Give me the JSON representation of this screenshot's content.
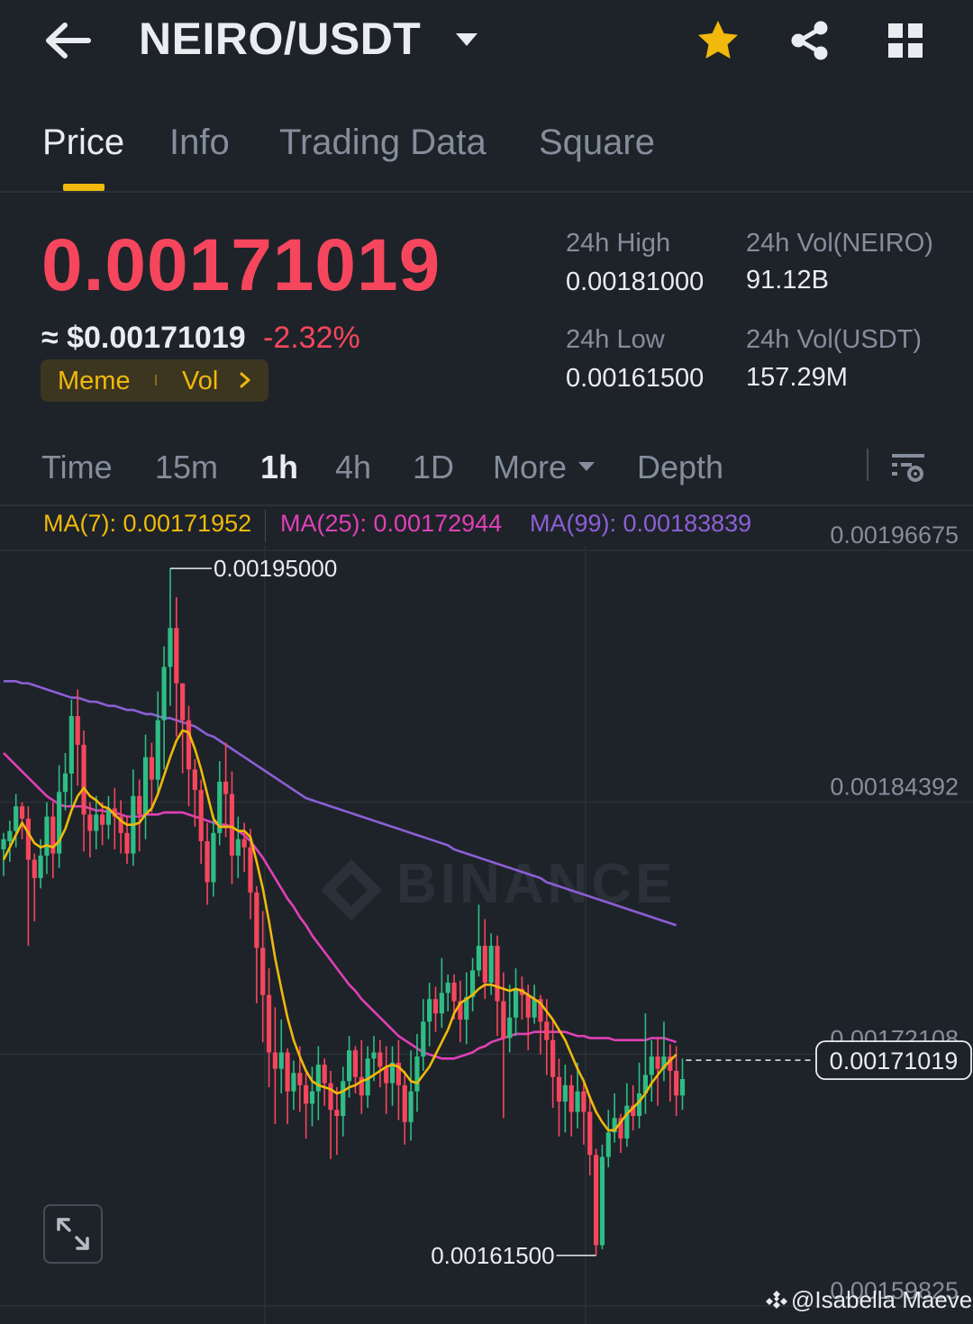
{
  "header": {
    "title": "NEIRO/USDT"
  },
  "tabs": [
    {
      "label": "Price",
      "active": true
    },
    {
      "label": "Info",
      "active": false
    },
    {
      "label": "Trading Data",
      "active": false
    },
    {
      "label": "Square",
      "active": false
    }
  ],
  "ticker": {
    "last_price": "0.00171019",
    "usd_price": "≈ $0.00171019",
    "change_pct": "-2.32%",
    "tags": {
      "meme": "Meme",
      "vol": "Vol"
    },
    "stats": {
      "high_label": "24h High",
      "high_value": "0.00181000",
      "low_label": "24h Low",
      "low_value": "0.00161500",
      "vol_base_label": "24h Vol(NEIRO)",
      "vol_base_value": "91.12B",
      "vol_quote_label": "24h Vol(USDT)",
      "vol_quote_value": "157.29M"
    }
  },
  "intervals": [
    {
      "label": "Time",
      "active": false
    },
    {
      "label": "15m",
      "active": false
    },
    {
      "label": "1h",
      "active": true
    },
    {
      "label": "4h",
      "active": false
    },
    {
      "label": "1D",
      "active": false
    },
    {
      "label": "More",
      "active": false
    },
    {
      "label": "Depth",
      "active": false
    }
  ],
  "ma_labels": {
    "ma7": "MA(7): 0.00171952",
    "ma25": "MA(25): 0.00172944",
    "ma99": "MA(99): 0.00183839"
  },
  "colors": {
    "up": "#2ebd85",
    "down": "#f6465d",
    "accent": "#f0b90b",
    "ma7": "#f0b90b",
    "ma25": "#e040b8",
    "ma99": "#8c5fd6"
  },
  "watermark": "BINANCE",
  "credit": "@Isabella Maeve",
  "chart_data": {
    "type": "candlestick",
    "y_ticks": [
      "0.00196675",
      "0.00184392",
      "0.00172108",
      "0.00159825"
    ],
    "ylim": [
      0.00158,
      0.00201
    ],
    "current_price_label": "0.00171019",
    "current_price": 0.00171019,
    "high_marker": {
      "label": "0.00195000",
      "value": 0.00195,
      "candle_index": 27
    },
    "low_marker": {
      "label": "0.00161500",
      "value": 0.001615,
      "candle_index": 96
    },
    "candles": [
      [
        0.001813,
        0.001818,
        0.0018,
        0.001821
      ],
      [
        0.001817,
        0.001822,
        0.001807,
        0.001827
      ],
      [
        0.001822,
        0.001834,
        0.001814,
        0.00184
      ],
      [
        0.001834,
        0.001828,
        0.001818,
        0.001836
      ],
      [
        0.001828,
        0.001808,
        0.001766,
        0.001834
      ],
      [
        0.001808,
        0.001799,
        0.001778,
        0.001811
      ],
      [
        0.001799,
        0.00181,
        0.001794,
        0.001818
      ],
      [
        0.00181,
        0.001829,
        0.001801,
        0.001836
      ],
      [
        0.001829,
        0.001811,
        0.001799,
        0.001836
      ],
      [
        0.001811,
        0.001841,
        0.001804,
        0.001854
      ],
      [
        0.001841,
        0.00185,
        0.001832,
        0.00186
      ],
      [
        0.00185,
        0.001878,
        0.001834,
        0.001886
      ],
      [
        0.001878,
        0.001864,
        0.001844,
        0.001891
      ],
      [
        0.001864,
        0.00183,
        0.001812,
        0.001871
      ],
      [
        0.00183,
        0.001822,
        0.001809,
        0.001836
      ],
      [
        0.001822,
        0.00183,
        0.001813,
        0.001839
      ],
      [
        0.00183,
        0.001825,
        0.001815,
        0.001836
      ],
      [
        0.001825,
        0.001833,
        0.001818,
        0.001839
      ],
      [
        0.001833,
        0.001829,
        0.001813,
        0.001843
      ],
      [
        0.001829,
        0.001821,
        0.001811,
        0.001837
      ],
      [
        0.001821,
        0.001811,
        0.001806,
        0.001829
      ],
      [
        0.001811,
        0.001839,
        0.001805,
        0.001852
      ],
      [
        0.001839,
        0.00183,
        0.001812,
        0.001847
      ],
      [
        0.00183,
        0.001858,
        0.001818,
        0.001869
      ],
      [
        0.001858,
        0.001847,
        0.001831,
        0.001865
      ],
      [
        0.001847,
        0.001876,
        0.00184,
        0.00189
      ],
      [
        0.001876,
        0.001902,
        0.001852,
        0.001912
      ],
      [
        0.001902,
        0.001921,
        0.001883,
        0.00195
      ],
      [
        0.001921,
        0.001894,
        0.001868,
        0.001936
      ],
      [
        0.001894,
        0.001876,
        0.00185,
        0.00189
      ],
      [
        0.001876,
        0.001852,
        0.001834,
        0.001883
      ],
      [
        0.001852,
        0.001842,
        0.001824,
        0.001857
      ],
      [
        0.001842,
        0.001817,
        0.001806,
        0.001847
      ],
      [
        0.001817,
        0.001797,
        0.001786,
        0.001826
      ],
      [
        0.001797,
        0.001821,
        0.00179,
        0.00183
      ],
      [
        0.001821,
        0.001846,
        0.001815,
        0.001856
      ],
      [
        0.001846,
        0.00184,
        0.001819,
        0.001865
      ],
      [
        0.00184,
        0.00181,
        0.001796,
        0.001851
      ],
      [
        0.00181,
        0.001818,
        0.001799,
        0.001829
      ],
      [
        0.001818,
        0.001814,
        0.001802,
        0.001826
      ],
      [
        0.001814,
        0.001792,
        0.001779,
        0.001823
      ],
      [
        0.001792,
        0.001765,
        0.001738,
        0.001795
      ],
      [
        0.001765,
        0.001742,
        0.001719,
        0.001783
      ],
      [
        0.001742,
        0.001714,
        0.001697,
        0.001755
      ],
      [
        0.001714,
        0.001706,
        0.001679,
        0.001736
      ],
      [
        0.001706,
        0.001714,
        0.001694,
        0.00173
      ],
      [
        0.001714,
        0.001695,
        0.001679,
        0.001716
      ],
      [
        0.001695,
        0.001704,
        0.001686,
        0.00171
      ],
      [
        0.001704,
        0.001698,
        0.001685,
        0.001717
      ],
      [
        0.001698,
        0.001689,
        0.001672,
        0.001704
      ],
      [
        0.001689,
        0.001695,
        0.001678,
        0.001707
      ],
      [
        0.001695,
        0.001708,
        0.001681,
        0.001717
      ],
      [
        0.001708,
        0.001699,
        0.001688,
        0.001711
      ],
      [
        0.001699,
        0.001686,
        0.001662,
        0.001705
      ],
      [
        0.001686,
        0.001683,
        0.001664,
        0.001697
      ],
      [
        0.001683,
        0.0017,
        0.001673,
        0.001707
      ],
      [
        0.0017,
        0.001715,
        0.001692,
        0.001722
      ],
      [
        0.001715,
        0.001702,
        0.001694,
        0.001717
      ],
      [
        0.001702,
        0.001693,
        0.001684,
        0.00172
      ],
      [
        0.001693,
        0.001711,
        0.001687,
        0.001717
      ],
      [
        0.001711,
        0.001714,
        0.0017,
        0.001722
      ],
      [
        0.001714,
        0.001707,
        0.001697,
        0.00172
      ],
      [
        0.001707,
        0.001699,
        0.001684,
        0.001717
      ],
      [
        0.001699,
        0.001709,
        0.001688,
        0.001717
      ],
      [
        0.001709,
        0.001698,
        0.001681,
        0.00172
      ],
      [
        0.001698,
        0.00168,
        0.001669,
        0.001705
      ],
      [
        0.00168,
        0.001695,
        0.001671,
        0.001715
      ],
      [
        0.001695,
        0.001712,
        0.001685,
        0.001723
      ],
      [
        0.001712,
        0.001729,
        0.001705,
        0.00174
      ],
      [
        0.001729,
        0.00174,
        0.001717,
        0.001748
      ],
      [
        0.00174,
        0.001733,
        0.001724,
        0.001746
      ],
      [
        0.001733,
        0.001743,
        0.001726,
        0.00176
      ],
      [
        0.001743,
        0.001748,
        0.001734,
        0.001752
      ],
      [
        0.001748,
        0.001739,
        0.00173,
        0.001752
      ],
      [
        0.001739,
        0.00173,
        0.001719,
        0.001749
      ],
      [
        0.00173,
        0.001741,
        0.001718,
        0.001753
      ],
      [
        0.001741,
        0.001754,
        0.001734,
        0.00176
      ],
      [
        0.001754,
        0.001766,
        0.001751,
        0.001786
      ],
      [
        0.001766,
        0.001748,
        0.00174,
        0.001779
      ],
      [
        0.001748,
        0.001766,
        0.001742,
        0.001772
      ],
      [
        0.001766,
        0.001739,
        0.001722,
        0.001771
      ],
      [
        0.001739,
        0.001721,
        0.001682,
        0.001753
      ],
      [
        0.001721,
        0.001731,
        0.001714,
        0.001747
      ],
      [
        0.001731,
        0.001745,
        0.001722,
        0.001755
      ],
      [
        0.001745,
        0.001742,
        0.00173,
        0.001751
      ],
      [
        0.001742,
        0.001731,
        0.001715,
        0.001747
      ],
      [
        0.001731,
        0.00174,
        0.001728,
        0.001747
      ],
      [
        0.00174,
        0.001729,
        0.001713,
        0.001742
      ],
      [
        0.001729,
        0.00172,
        0.001703,
        0.00174
      ],
      [
        0.00172,
        0.001702,
        0.001687,
        0.00173
      ],
      [
        0.001702,
        0.00169,
        0.001673,
        0.001711
      ],
      [
        0.00169,
        0.001698,
        0.001675,
        0.001708
      ],
      [
        0.001698,
        0.001685,
        0.001673,
        0.001703
      ],
      [
        0.001685,
        0.001695,
        0.001677,
        0.001709
      ],
      [
        0.001695,
        0.001685,
        0.001669,
        0.001699
      ],
      [
        0.001685,
        0.001664,
        0.001654,
        0.001693
      ],
      [
        0.001664,
        0.00162,
        0.001615,
        0.001667
      ],
      [
        0.00162,
        0.001663,
        0.001618,
        0.001669
      ],
      [
        0.001663,
        0.001675,
        0.001658,
        0.001686
      ],
      [
        0.001675,
        0.001682,
        0.00167,
        0.001694
      ],
      [
        0.001682,
        0.001672,
        0.001665,
        0.001684
      ],
      [
        0.001672,
        0.001688,
        0.001668,
        0.001699
      ],
      [
        0.001688,
        0.001683,
        0.001676,
        0.001698
      ],
      [
        0.001683,
        0.001694,
        0.001677,
        0.001709
      ],
      [
        0.001694,
        0.001703,
        0.001684,
        0.001733
      ],
      [
        0.001703,
        0.001712,
        0.00169,
        0.00172
      ],
      [
        0.001712,
        0.001706,
        0.001688,
        0.001721
      ],
      [
        0.001706,
        0.001712,
        0.0017,
        0.001729
      ],
      [
        0.001712,
        0.001705,
        0.00169,
        0.001718
      ],
      [
        0.001705,
        0.001693,
        0.001683,
        0.001717
      ],
      [
        0.001693,
        0.001701,
        0.001686,
        0.001711
      ]
    ],
    "ma7": [
      0.001808,
      0.001814,
      0.00182,
      0.001826,
      0.001821,
      0.001816,
      0.001814,
      0.001815,
      0.001814,
      0.001817,
      0.001823,
      0.001832,
      0.001839,
      0.001843,
      0.001839,
      0.001837,
      0.001834,
      0.001833,
      0.00183,
      0.001827,
      0.001825,
      0.001825,
      0.001826,
      0.00183,
      0.001833,
      0.00184,
      0.001849,
      0.001858,
      0.001866,
      0.001871,
      0.00187,
      0.001862,
      0.001852,
      0.00184,
      0.001828,
      0.001824,
      0.001824,
      0.001824,
      0.001822,
      0.001822,
      0.001819,
      0.001807,
      0.001794,
      0.001778,
      0.00176,
      0.001745,
      0.001731,
      0.00172,
      0.001712,
      0.001705,
      0.0017,
      0.001698,
      0.001697,
      0.001696,
      0.001694,
      0.001695,
      0.001697,
      0.001698,
      0.0017,
      0.001701,
      0.001703,
      0.001705,
      0.001707,
      0.001708,
      0.001707,
      0.001704,
      0.0017,
      0.001699,
      0.001703,
      0.001707,
      0.001713,
      0.001719,
      0.001725,
      0.001733,
      0.001738,
      0.00174,
      0.001742,
      0.001745,
      0.001747,
      0.001747,
      0.001746,
      0.001745,
      0.001744,
      0.001745,
      0.001744,
      0.001742,
      0.00174,
      0.001738,
      0.001734,
      0.00173,
      0.001725,
      0.00172,
      0.001713,
      0.001706,
      0.0017,
      0.001692,
      0.001685,
      0.00168,
      0.001676,
      0.001676,
      0.00168,
      0.001684,
      0.001687,
      0.00169,
      0.001694,
      0.001699,
      0.001703,
      0.001707,
      0.00171,
      0.001713
    ],
    "ma25": [
      0.00186,
      0.001857,
      0.001854,
      0.001851,
      0.001848,
      0.001845,
      0.001842,
      0.001839,
      0.001837,
      0.001835,
      0.001834,
      0.001834,
      0.001834,
      0.001834,
      0.001833,
      0.001832,
      0.001832,
      0.001831,
      0.001831,
      0.00183,
      0.001829,
      0.001829,
      0.001829,
      0.00183,
      0.00183,
      0.00183,
      0.001831,
      0.001831,
      0.001831,
      0.001831,
      0.00183,
      0.001829,
      0.001828,
      0.001827,
      0.001826,
      0.001825,
      0.001825,
      0.001824,
      0.001822,
      0.00182,
      0.001817,
      0.001813,
      0.001809,
      0.001804,
      0.001799,
      0.001794,
      0.001789,
      0.001785,
      0.00178,
      0.001776,
      0.001771,
      0.001767,
      0.001763,
      0.001759,
      0.001755,
      0.001751,
      0.001747,
      0.001744,
      0.00174,
      0.001737,
      0.001734,
      0.001731,
      0.001728,
      0.001725,
      0.001722,
      0.00172,
      0.001718,
      0.001716,
      0.001714,
      0.001713,
      0.001712,
      0.001711,
      0.001711,
      0.001711,
      0.001712,
      0.001713,
      0.001714,
      0.001716,
      0.001717,
      0.001719,
      0.00172,
      0.001721,
      0.001722,
      0.001723,
      0.001723,
      0.001723,
      0.001724,
      0.001724,
      0.001724,
      0.001724,
      0.001724,
      0.001724,
      0.001723,
      0.001722,
      0.001722,
      0.001721,
      0.001721,
      0.001721,
      0.001721,
      0.00172,
      0.00172,
      0.00172,
      0.00172,
      0.00172,
      0.00172,
      0.001721,
      0.001721,
      0.001721,
      0.00172,
      0.001719
    ],
    "ma99": [
      0.001895,
      0.001895,
      0.001895,
      0.001894,
      0.001894,
      0.001893,
      0.001892,
      0.001891,
      0.00189,
      0.001889,
      0.001888,
      0.001887,
      0.001887,
      0.001886,
      0.001885,
      0.001885,
      0.001884,
      0.001883,
      0.001883,
      0.001882,
      0.001881,
      0.001881,
      0.00188,
      0.001879,
      0.001879,
      0.001878,
      0.001877,
      0.001877,
      0.001876,
      0.001875,
      0.001874,
      0.001873,
      0.001871,
      0.001869,
      0.001868,
      0.001866,
      0.001864,
      0.001862,
      0.00186,
      0.001858,
      0.001856,
      0.001854,
      0.001852,
      0.00185,
      0.001848,
      0.001846,
      0.001844,
      0.001842,
      0.00184,
      0.001838,
      0.001837,
      0.001836,
      0.001835,
      0.001834,
      0.001833,
      0.001832,
      0.001831,
      0.00183,
      0.001829,
      0.001828,
      0.001827,
      0.001826,
      0.001825,
      0.001824,
      0.001823,
      0.001822,
      0.001821,
      0.00182,
      0.001819,
      0.001818,
      0.001817,
      0.001816,
      0.001815,
      0.001813,
      0.001812,
      0.001811,
      0.00181,
      0.001809,
      0.001808,
      0.001807,
      0.001806,
      0.001805,
      0.001804,
      0.001803,
      0.001802,
      0.001801,
      0.0018,
      0.001799,
      0.001797,
      0.001796,
      0.001795,
      0.001794,
      0.001793,
      0.001792,
      0.001791,
      0.00179,
      0.001789,
      0.001788,
      0.001787,
      0.001786,
      0.001785,
      0.001784,
      0.001783,
      0.001782,
      0.001781,
      0.00178,
      0.001779,
      0.001778,
      0.001777,
      0.001776
    ]
  }
}
